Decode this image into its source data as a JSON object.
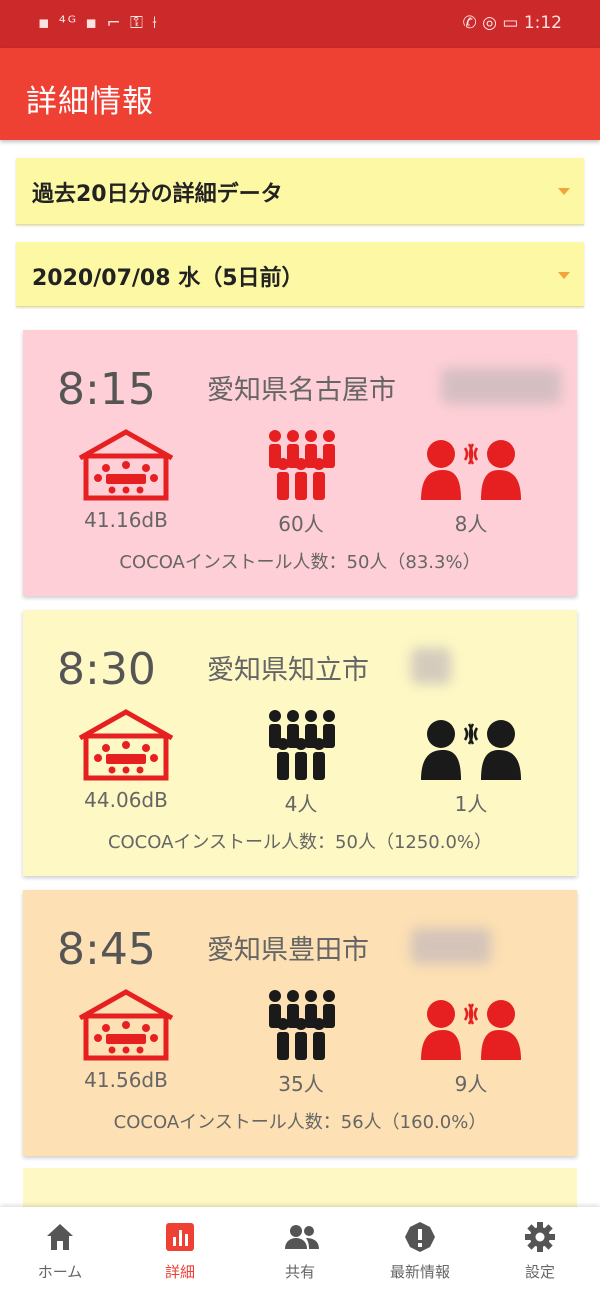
{
  "status_bar": {
    "left": "▪ ⁴ᴳ ▪ ⌐ ⚿ ⟊",
    "right": "✆ ◎ ▭ 1:12"
  },
  "app_bar": {
    "title": "詳細情報"
  },
  "dropdowns": {
    "period": "過去20日分の詳細データ",
    "date": "2020/07/08 水（5日前）"
  },
  "cards": [
    {
      "time": "8:15",
      "place": "愛知県名古屋市",
      "decibel": "41.16dB",
      "people": "60人",
      "contacts": "8人",
      "cocoa": "COCOAインストール人数：50人（83.3%）",
      "bg_color": "#fecfd6",
      "icon_colors": {
        "room": "#e62020",
        "people": "#e62020",
        "talk": "#e62020"
      }
    },
    {
      "time": "8:30",
      "place": "愛知県知立市",
      "decibel": "44.06dB",
      "people": "4人",
      "contacts": "1人",
      "cocoa": "COCOAインストール人数：50人（1250.0%）",
      "bg_color": "#fdf8c4",
      "icon_colors": {
        "room": "#e62020",
        "people": "#1a1a1a",
        "talk": "#1a1a1a"
      }
    },
    {
      "time": "8:45",
      "place": "愛知県豊田市",
      "decibel": "41.56dB",
      "people": "35人",
      "contacts": "9人",
      "cocoa": "COCOAインストール人数：56人（160.0%）",
      "bg_color": "#fde0b3",
      "icon_colors": {
        "room": "#e62020",
        "people": "#1a1a1a",
        "talk": "#e62020"
      }
    }
  ],
  "nav": [
    {
      "label": "ホーム",
      "icon": "home-icon",
      "active": false
    },
    {
      "label": "詳細",
      "icon": "chart-icon",
      "active": true
    },
    {
      "label": "共有",
      "icon": "people-icon",
      "active": false
    },
    {
      "label": "最新情報",
      "icon": "alert-icon",
      "active": false
    },
    {
      "label": "設定",
      "icon": "gear-icon",
      "active": false
    }
  ],
  "colors": {
    "accent": "#ef4034",
    "status_bar": "#cc2a2a",
    "dropdown_bg": "#fdf8a3"
  }
}
